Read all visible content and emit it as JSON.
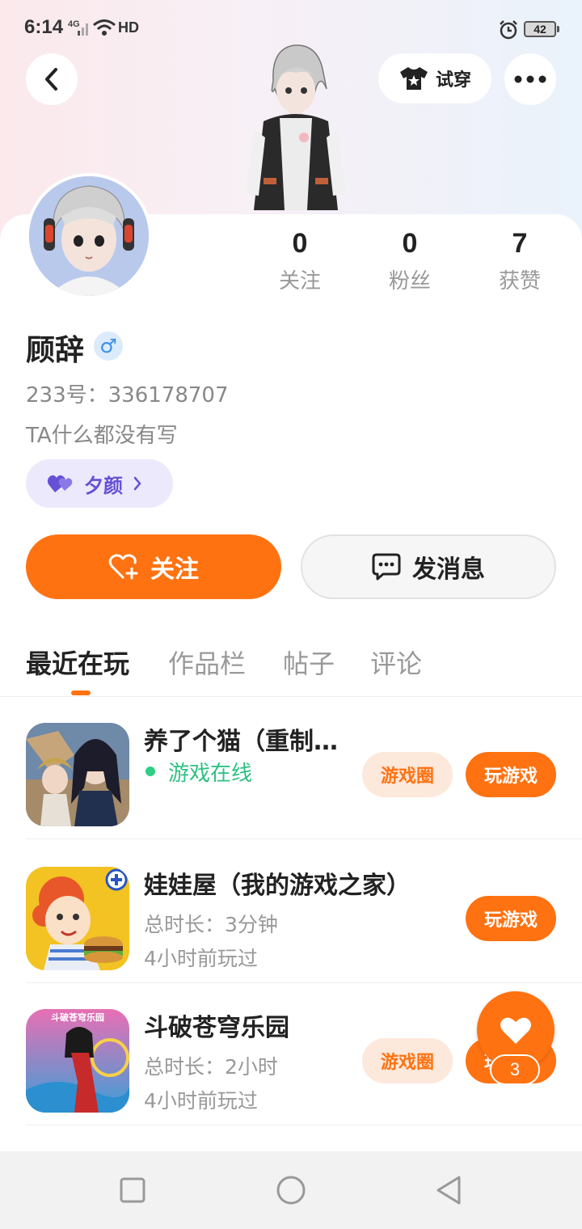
{
  "status_bar": {
    "time": "6:14",
    "network": "4G",
    "hd_label": "HD",
    "battery": "42"
  },
  "header": {
    "tryon_label": "试穿"
  },
  "stats": [
    {
      "value": "0",
      "label": "关注"
    },
    {
      "value": "0",
      "label": "粉丝"
    },
    {
      "value": "7",
      "label": "获赞"
    }
  ],
  "profile": {
    "name": "顾辞",
    "gender_symbol": "♂",
    "id_text": "233号：336178707",
    "bio": "TA什么都没有写",
    "tag_label": "夕颜"
  },
  "actions": {
    "follow_label": "关注",
    "message_label": "发消息"
  },
  "tabs": [
    {
      "label": "最近在玩",
      "active": true
    },
    {
      "label": "作品栏",
      "active": false
    },
    {
      "label": "帖子",
      "active": false
    },
    {
      "label": "评论",
      "active": false
    }
  ],
  "games": [
    {
      "title": "养了个猫（重制版）",
      "status": "游戏在线",
      "circle_label": "游戏圈",
      "play_label": "玩游戏"
    },
    {
      "title": "娃娃屋（我的游戏之家）",
      "duration": "总时长：3分钟",
      "last_played": "4小时前玩过",
      "play_label": "玩游戏"
    },
    {
      "title": "斗破苍穹乐园",
      "duration": "总时长：2小时",
      "last_played": "4小时前玩过",
      "circle_label": "游戏圈",
      "play_label": "玩游戏",
      "icon_text": "斗破苍穹乐园"
    }
  ],
  "fab": {
    "count": "3"
  },
  "colors": {
    "accent": "#ff7211",
    "online": "#2fc183",
    "tag": "#6650d6"
  }
}
